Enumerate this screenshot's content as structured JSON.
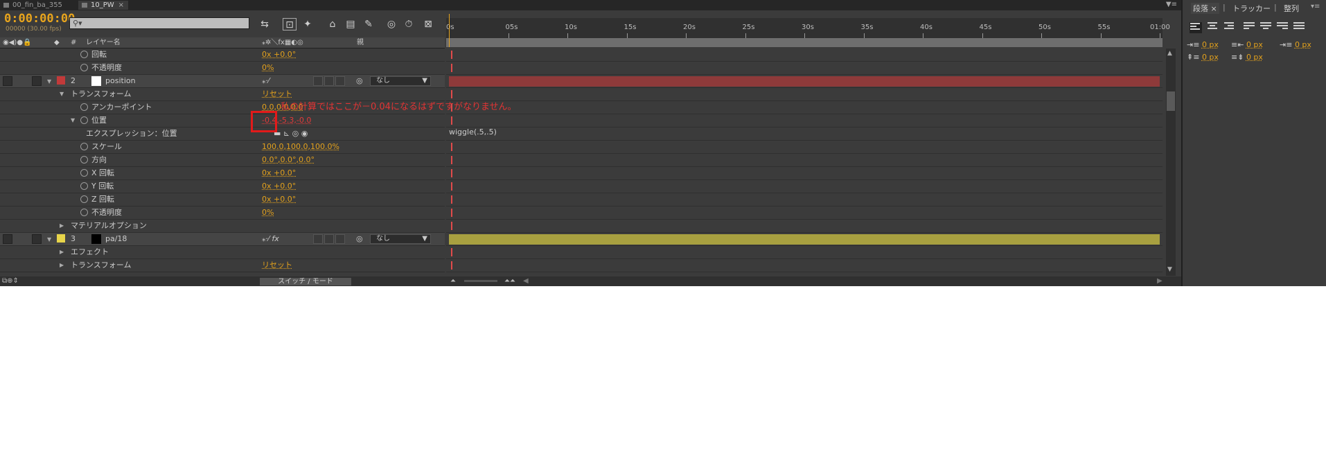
{
  "tabs": [
    {
      "label": "00_fin_ba_355",
      "active": false
    },
    {
      "label": "10_PW",
      "active": true,
      "close": "×"
    }
  ],
  "header": {
    "timecode": "0:00:00:00",
    "fps_label": "00000 (30.00 fps)",
    "search_placeholder": ""
  },
  "columns": {
    "layer_name": "レイヤー名",
    "number": "#",
    "parent": "親"
  },
  "ruler": {
    "ticks": [
      "0s",
      "05s",
      "10s",
      "15s",
      "20s",
      "25s",
      "30s",
      "35s",
      "40s",
      "45s",
      "50s",
      "55s",
      "01:00"
    ]
  },
  "rows": [
    {
      "type": "prop",
      "indent": 2,
      "stopwatch": true,
      "label": "回転",
      "value": "0x +0.0°"
    },
    {
      "type": "prop",
      "indent": 2,
      "stopwatch": true,
      "label": "不透明度",
      "value": "0%"
    },
    {
      "type": "layer",
      "index": "2",
      "color": "#c23a3a",
      "swatch": "#ffffff",
      "name": "position",
      "parent": "なし",
      "bar": "#8e3a3a"
    },
    {
      "type": "group",
      "indent": 1,
      "label": "トランスフォーム",
      "value": "リセット"
    },
    {
      "type": "prop",
      "indent": 2,
      "stopwatch": true,
      "label": "アンカーポイント",
      "value": "0.0,0.0,0.0"
    },
    {
      "type": "prop",
      "indent": 2,
      "stopwatch": true,
      "expanded": true,
      "label": "位置",
      "value": "-0.4,-5.3,-0.0",
      "value_color": "#e23a3a"
    },
    {
      "type": "expr",
      "indent": 3,
      "label": "エクスプレッション：位置",
      "expr": "wiggle(.5,.5)"
    },
    {
      "type": "prop",
      "indent": 2,
      "stopwatch": true,
      "label": "スケール",
      "value": "100.0,100.0,100.0%"
    },
    {
      "type": "prop",
      "indent": 2,
      "stopwatch": true,
      "label": "方向",
      "value": "0.0°,0.0°,0.0°"
    },
    {
      "type": "prop",
      "indent": 2,
      "stopwatch": true,
      "label": "X 回転",
      "value": "0x +0.0°"
    },
    {
      "type": "prop",
      "indent": 2,
      "stopwatch": true,
      "label": "Y 回転",
      "value": "0x +0.0°"
    },
    {
      "type": "prop",
      "indent": 2,
      "stopwatch": true,
      "label": "Z 回転",
      "value": "0x +0.0°"
    },
    {
      "type": "prop",
      "indent": 2,
      "stopwatch": true,
      "label": "不透明度",
      "value": "0%"
    },
    {
      "type": "group",
      "indent": 1,
      "collapsed": true,
      "label": "マテリアルオプション",
      "value": ""
    },
    {
      "type": "layer",
      "index": "3",
      "color": "#e8d54a",
      "swatch": "#000000",
      "name": "pa/18",
      "parent": "なし",
      "bar": "#a8a040",
      "fx": true
    },
    {
      "type": "group",
      "indent": 1,
      "collapsed": true,
      "label": "エフェクト",
      "value": ""
    },
    {
      "type": "group",
      "indent": 1,
      "collapsed": true,
      "label": "トランスフォーム",
      "value": "リセット"
    }
  ],
  "annotation": {
    "text": "私の計算ではここが－0.04になるはずですがなりません。",
    "color": "#e21a1a"
  },
  "footer": {
    "switch_mode": "スイッチ / モード"
  },
  "panel": {
    "tabs": [
      "段落",
      "トラッカー",
      "整列"
    ],
    "indent_values": [
      "0 px",
      "0 px",
      "0 px",
      "0 px",
      "0 px"
    ]
  }
}
